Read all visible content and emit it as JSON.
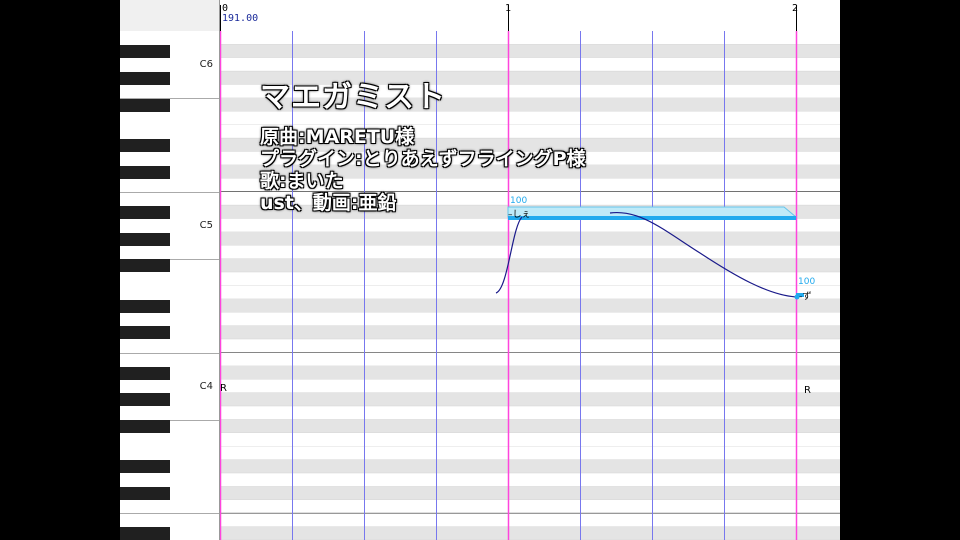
{
  "ruler": {
    "measures": [
      "0",
      "1",
      "2"
    ],
    "tempo": "191.00"
  },
  "keyboard": {
    "octave_labels": [
      "C6",
      "C5",
      "C4"
    ]
  },
  "notes": [
    {
      "lyric": "しぇ",
      "velocity": "100"
    },
    {
      "lyric": "ず",
      "velocity": "100"
    }
  ],
  "rests": [
    "R",
    "R"
  ],
  "overlay": {
    "title": "マエガミスト",
    "credits": [
      "原曲:MARETU様",
      "プラグイン:とりあえずフライングP様",
      "歌:まいた",
      "ust、動画:亜鉛"
    ]
  },
  "colors": {
    "bar_line": "#ff44dd",
    "beat_line": "#7777ee",
    "note": "#22aaee",
    "pitch_curve": "#1a1a8a"
  }
}
